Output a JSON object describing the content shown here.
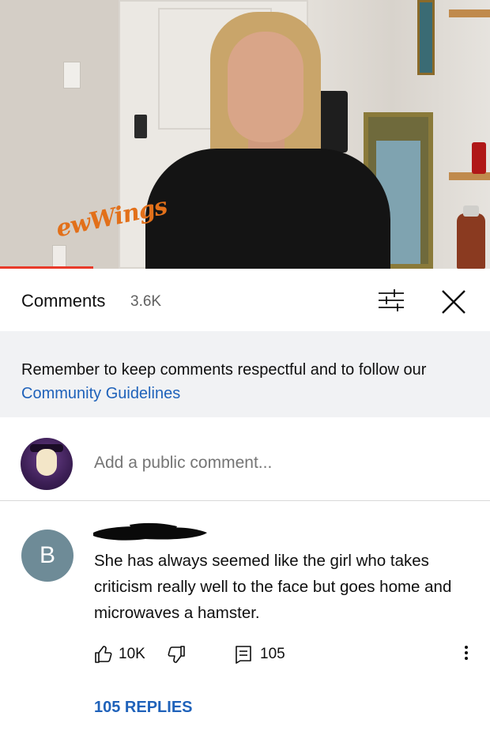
{
  "header": {
    "title": "Comments",
    "count": "3.6K"
  },
  "banner": {
    "text": "Remember to keep comments respectful and to follow our",
    "link": "Community Guidelines"
  },
  "add_comment": {
    "placeholder": "Add a public comment..."
  },
  "comment": {
    "avatar_letter": "B",
    "text": "She has always seemed like the girl who takes criticism really well to the face but goes home and microwaves a hamster.",
    "likes": "10K",
    "reply_count": "105",
    "replies_link": "105 REPLIES"
  },
  "video": {
    "shirt_text": "ewWings",
    "progress": 0.19
  },
  "colors": {
    "link": "#1f62ba",
    "progress": "#e83a2a",
    "banner_bg": "#f1f2f4",
    "avatar_bg": "#6e8b97"
  },
  "icons": [
    "filter-sliders-icon",
    "close-icon",
    "thumbs-up-icon",
    "thumbs-down-icon",
    "reply-comment-icon",
    "more-vertical-icon"
  ]
}
